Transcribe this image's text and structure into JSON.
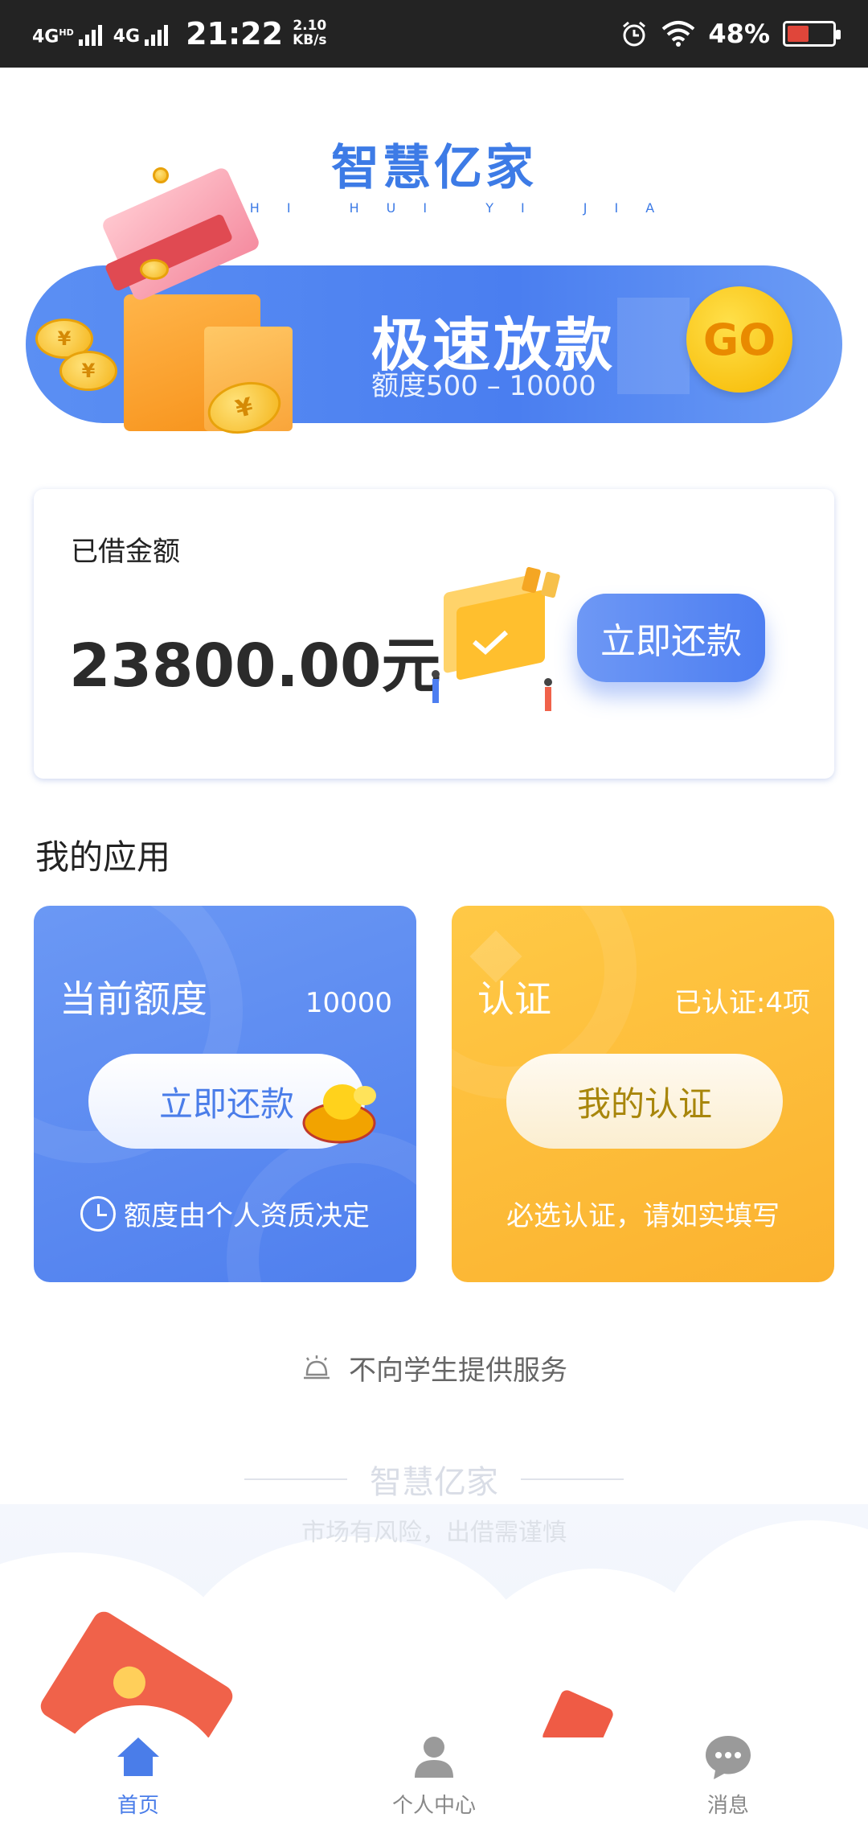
{
  "status_bar": {
    "signal1_label": "4G",
    "signal1_sup": "HD",
    "signal2_label": "4G",
    "time": "21:22",
    "speed_value": "2.10",
    "speed_unit": "KB/s",
    "battery_pct": "48%",
    "battery_level": 0.48,
    "icons": [
      "alarm-icon",
      "wifi-icon",
      "battery-icon"
    ]
  },
  "logo": {
    "title": "智慧亿家",
    "pinyin": "ZHI HUI YI JIA"
  },
  "hero": {
    "title": "极速放款",
    "subtitle": "额度500 – 10000",
    "go_label": "GO"
  },
  "borrowed": {
    "label": "已借金额",
    "amount": "23800.00元",
    "repay_button": "立即还款"
  },
  "apps": {
    "section_title": "我的应用",
    "quota": {
      "title": "当前额度",
      "value": "10000",
      "button": "立即还款",
      "footnote": "额度由个人资质决定"
    },
    "auth": {
      "title": "认证",
      "value": "已认证:4项",
      "button": "我的认证",
      "footnote": "必选认证，请如实填写"
    }
  },
  "notice": {
    "text": "不向学生提供服务"
  },
  "footer_brand": {
    "name": "智慧亿家",
    "tagline": "市场有风险，出借需谨慎"
  },
  "bottom_nav": {
    "items": [
      {
        "label": "首页",
        "icon": "home-icon",
        "active": true
      },
      {
        "label": "个人中心",
        "icon": "person-icon",
        "active": false
      },
      {
        "label": "消息",
        "icon": "chat-icon",
        "active": false
      }
    ]
  },
  "colors": {
    "brand_blue": "#4a7de9",
    "accent_yellow": "#fbb22f",
    "status_bar": "#232323"
  }
}
